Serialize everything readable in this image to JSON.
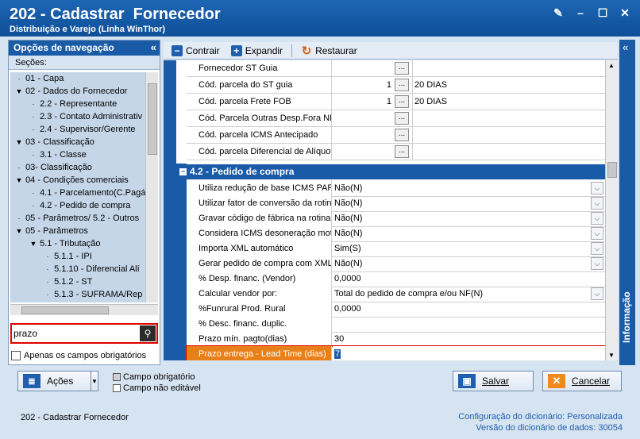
{
  "window": {
    "title": "202 - Cadastrar  Fornecedor",
    "subtitle": "Distribuição e Varejo (Linha WinThor)"
  },
  "nav": {
    "header": "Opções de navegação",
    "sections_label": "Seções:",
    "tree": [
      {
        "label": "01 - Capa",
        "level": 0,
        "exp": ""
      },
      {
        "label": "02 - Dados do Fornecedor",
        "level": 0,
        "exp": "▼"
      },
      {
        "label": "2.2 - Representante",
        "level": 1,
        "exp": ""
      },
      {
        "label": "2.3 - Contato Administrativ",
        "level": 1,
        "exp": ""
      },
      {
        "label": "2.4 - Supervisor/Gerente",
        "level": 1,
        "exp": ""
      },
      {
        "label": "03 - Classificação",
        "level": 0,
        "exp": "▼"
      },
      {
        "label": "3.1 - Classe",
        "level": 1,
        "exp": ""
      },
      {
        "label": "03- Classificação",
        "level": 0,
        "exp": ""
      },
      {
        "label": "04 - Condições comerciais",
        "level": 0,
        "exp": "▼"
      },
      {
        "label": "4.1 - Parcelamento(C.Pagá",
        "level": 1,
        "exp": ""
      },
      {
        "label": "4.2 - Pedido de compra",
        "level": 1,
        "exp": ""
      },
      {
        "label": "05 - Parâmetros/ 5.2 - Outros",
        "level": 0,
        "exp": ""
      },
      {
        "label": "05 - Parâmetros",
        "level": 0,
        "exp": "▼"
      },
      {
        "label": "5.1 - Tributação",
        "level": 1,
        "exp": "▼"
      },
      {
        "label": "5.1.1 - IPI",
        "level": 2,
        "exp": ""
      },
      {
        "label": "5.1.10 - Diferencial Alí",
        "level": 2,
        "exp": ""
      },
      {
        "label": "5.1.2 - ST",
        "level": 2,
        "exp": ""
      },
      {
        "label": "5.1.3 - SUFRAMA/Rep",
        "level": 2,
        "exp": ""
      }
    ],
    "search_value": "prazo",
    "only_required_label": "Apenas os campos obrigatórios"
  },
  "toolbar": {
    "collapse": "Contrair",
    "expand": "Expandir",
    "restore": "Restaurar"
  },
  "grid": {
    "rows_top": [
      {
        "label": "Fornecedor ST Guia",
        "num": "",
        "desc": ""
      },
      {
        "label": "Cód. parcela do ST guia",
        "num": "1",
        "desc": "20 DIAS"
      },
      {
        "label": "Cód. parcela Frete FOB",
        "num": "1",
        "desc": "20 DIAS"
      },
      {
        "label": "Cód. Parcela Outras Desp.Fora NF",
        "num": "",
        "desc": ""
      },
      {
        "label": "Cód. parcela ICMS Antecipado",
        "num": "",
        "desc": ""
      },
      {
        "label": "Cód. parcela Diferencial de Alíquot",
        "num": "",
        "desc": ""
      }
    ],
    "section_title": "4.2 - Pedido de compra",
    "rows_section": [
      {
        "label": "Utiliza redução de base ICMS PARA",
        "value": "Não(N)",
        "dropdown": true
      },
      {
        "label": "Utilizar fator de conversão da rotin",
        "value": "Não(N)",
        "dropdown": true
      },
      {
        "label": "Gravar código de fábrica na rotina",
        "value": "Não(N)",
        "dropdown": true
      },
      {
        "label": "Considera ICMS desoneração moti",
        "value": "Não(N)",
        "dropdown": true
      },
      {
        "label": "Importa XML automático",
        "value": "Sim(S)",
        "dropdown": true
      },
      {
        "label": "Gerar pedido de compra com XML",
        "value": "Não(N)",
        "dropdown": true
      },
      {
        "label": "% Desp. financ. (Vendor)",
        "value": "0,0000",
        "dropdown": false
      },
      {
        "label": "Calcular vendor por:",
        "value": "Total do pedido de compra e/ou NF(N)",
        "dropdown": true
      },
      {
        "label": "%Funrural Prod. Rural",
        "value": "0,0000",
        "dropdown": false
      },
      {
        "label": "% Desc. financ. duplic.",
        "value": "",
        "dropdown": false
      },
      {
        "label": "Prazo mín. pagto(dias)",
        "value": "30",
        "dropdown": false
      }
    ],
    "highlight_row": {
      "label": "Prazo entrega - Lead Time (dias)",
      "value": "7"
    }
  },
  "info_tab": "Informação",
  "buttons": {
    "actions": "Ações",
    "save": "Salvar",
    "cancel": "Cancelar"
  },
  "legend": {
    "required": "Campo obrigatório",
    "not_editable": "Campo não editável"
  },
  "status": {
    "left": "202 - Cadastrar  Fornecedor",
    "dict_config_label": "Configuração do dicionário:",
    "dict_config_value": "Personalizada",
    "dict_version_label": "Versão do dicionário de dados:",
    "dict_version_value": "30054"
  },
  "colors": {
    "titlebar": "#1a5ba8",
    "highlight": "#e8801a",
    "alert_border": "#e00000"
  }
}
